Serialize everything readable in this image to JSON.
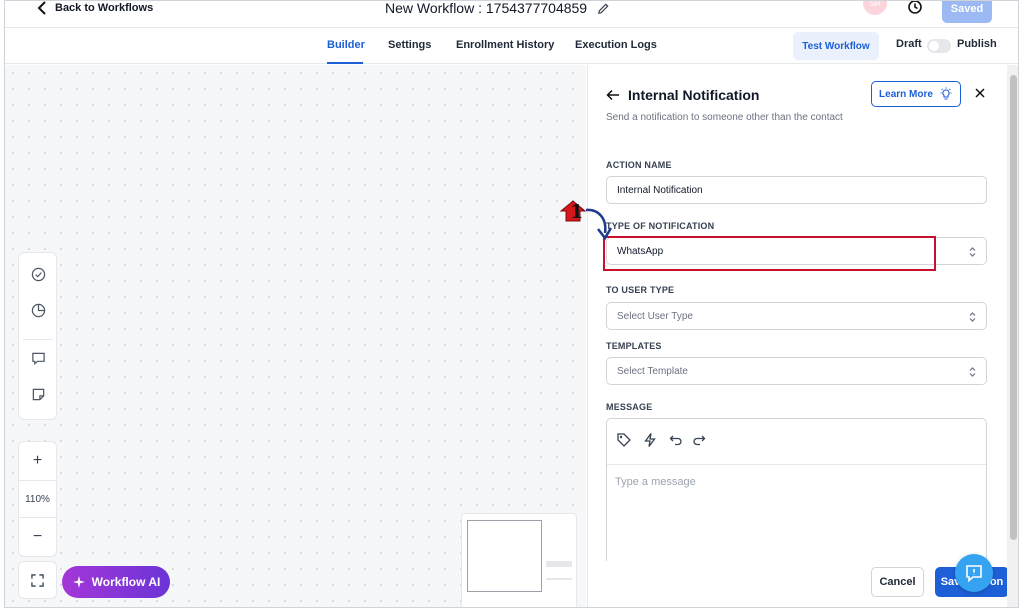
{
  "topbar": {
    "back_label": "Back to Workflows",
    "workflow_title": "New Workflow : 1754377704859",
    "avatar_initials": "SR",
    "saved_label": "Saved"
  },
  "tabs": [
    "Builder",
    "Settings",
    "Enrollment History",
    "Execution Logs"
  ],
  "active_tab": "Builder",
  "toolbar": {
    "test_workflow_label": "Test Workflow",
    "draft_label": "Draft",
    "publish_label": "Publish",
    "publish_toggle_on": false
  },
  "canvas": {
    "zoom_in": "+",
    "zoom_level": "110%",
    "zoom_out": "−",
    "workflow_ai_label": "Workflow AI",
    "tool_icons": [
      "check-circle-icon",
      "pie-chart-icon",
      "comment-icon",
      "sticky-note-icon"
    ]
  },
  "panel": {
    "title": "Internal Notification",
    "subtitle": "Send a notification to someone other than the contact",
    "learn_more_label": "Learn More",
    "action_name_label": "ACTION NAME",
    "action_name_value": "Internal Notification",
    "type_label": "TYPE OF NOTIFICATION",
    "type_value": "WhatsApp",
    "to_user_type_label": "TO USER TYPE",
    "to_user_type_placeholder": "Select User Type",
    "templates_label": "TEMPLATES",
    "templates_placeholder": "Select Template",
    "message_label": "MESSAGE",
    "message_placeholder": "Type a message",
    "cancel_label": "Cancel",
    "save_label": "Save Action"
  },
  "annotation": {
    "step_number": "1",
    "highlight_color": "#c8102e"
  },
  "colors": {
    "accent": "#1d5fd6",
    "ai_gradient_start": "#a437d8",
    "ai_gradient_end": "#6b34d6",
    "chat_bubble": "#36a3f2"
  }
}
